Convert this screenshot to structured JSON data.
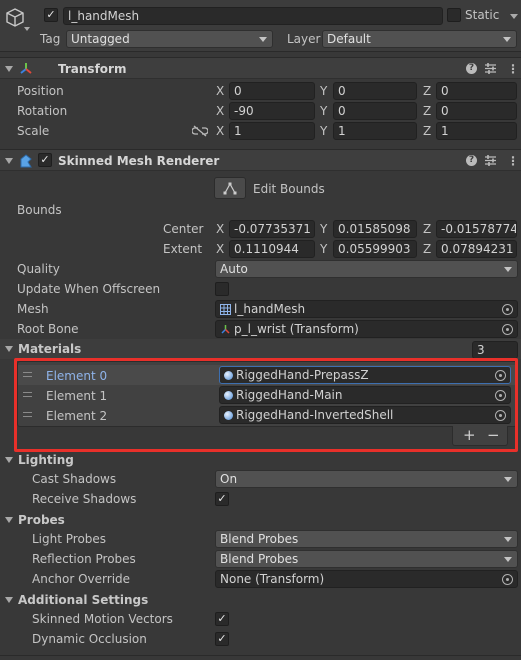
{
  "header": {
    "object_name": "l_handMesh",
    "static_label": "Static",
    "tag_label": "Tag",
    "tag_value": "Untagged",
    "layer_label": "Layer",
    "layer_value": "Default"
  },
  "transform": {
    "title": "Transform",
    "position_label": "Position",
    "rotation_label": "Rotation",
    "scale_label": "Scale",
    "axes": [
      "X",
      "Y",
      "Z"
    ],
    "position": [
      "0",
      "0",
      "0"
    ],
    "rotation": [
      "-90",
      "0",
      "0"
    ],
    "scale": [
      "1",
      "1",
      "1"
    ]
  },
  "renderer": {
    "title": "Skinned Mesh Renderer",
    "edit_bounds_label": "Edit Bounds",
    "bounds_label": "Bounds",
    "center_label": "Center",
    "extent_label": "Extent",
    "center": [
      "-0.07735371",
      "0.01585098",
      "-0.01578774"
    ],
    "extent": [
      "0.1110944",
      "0.05599903",
      "0.07894231"
    ],
    "quality_label": "Quality",
    "quality_value": "Auto",
    "update_offscreen_label": "Update When Offscreen",
    "mesh_label": "Mesh",
    "mesh_value": "l_handMesh",
    "root_bone_label": "Root Bone",
    "root_bone_value": "p_l_wrist (Transform)"
  },
  "materials": {
    "title": "Materials",
    "count": "3",
    "elements": [
      {
        "label": "Element 0",
        "value": "RiggedHand-PrepassZ"
      },
      {
        "label": "Element 1",
        "value": "RiggedHand-Main"
      },
      {
        "label": "Element 2",
        "value": "RiggedHand-InvertedShell"
      }
    ],
    "add_label": "+",
    "remove_label": "−"
  },
  "lighting": {
    "title": "Lighting",
    "cast_shadows_label": "Cast Shadows",
    "cast_shadows_value": "On",
    "receive_shadows_label": "Receive Shadows"
  },
  "probes": {
    "title": "Probes",
    "light_probes_label": "Light Probes",
    "light_probes_value": "Blend Probes",
    "reflection_probes_label": "Reflection Probes",
    "reflection_probes_value": "Blend Probes",
    "anchor_override_label": "Anchor Override",
    "anchor_override_value": "None (Transform)"
  },
  "additional": {
    "title": "Additional Settings",
    "motion_vectors_label": "Skinned Motion Vectors",
    "dynamic_occlusion_label": "Dynamic Occlusion"
  },
  "icons": {
    "check": "✓",
    "help": "?",
    "menu": "⋮"
  },
  "colors": {
    "highlight_border": "#e8302a",
    "selected_element_text": "#8fb4ea",
    "background": "#383838"
  }
}
